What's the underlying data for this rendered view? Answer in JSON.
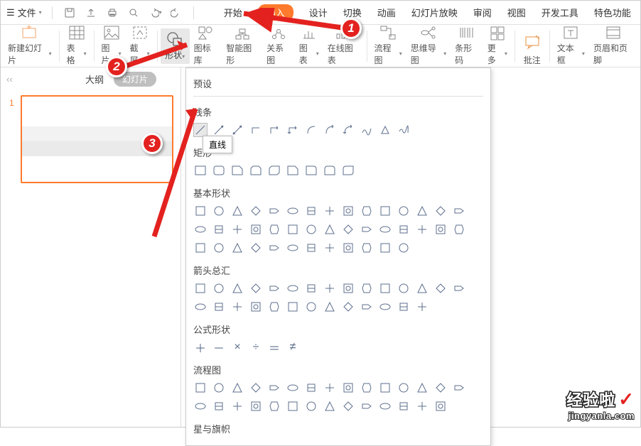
{
  "menubar": {
    "file_label": "文件",
    "tabs": [
      "开始",
      "插入",
      "设计",
      "切换",
      "动画",
      "幻灯片放映",
      "审阅",
      "视图",
      "开发工具",
      "特色功能"
    ],
    "active_tab_index": 1
  },
  "ribbon": {
    "new_slide": "新建幻灯片",
    "table": "表格",
    "image": "图片",
    "screenshot": "截屏",
    "shapes": "形状",
    "icon_lib": "图标库",
    "smart_shape": "智能图形",
    "relation": "关系图",
    "chart": "图表",
    "online_chart": "在线图表",
    "flowchart": "流程图",
    "mindmap": "思维导图",
    "barcode": "条形码",
    "more": "更多",
    "annotate": "批注",
    "textbox": "文本框",
    "header_footer": "页眉和页脚"
  },
  "left_pane": {
    "outline": "大纲",
    "slides": "幻灯片",
    "slide_index": "1"
  },
  "shapes_panel": {
    "presets": "预设",
    "lines": "线条",
    "rectangles": "矩形",
    "basic_shapes": "基本形状",
    "arrows": "箭头总汇",
    "formula": "公式形状",
    "flowchart": "流程图",
    "stars": "星与旗帜"
  },
  "tooltip": {
    "text": "直线"
  },
  "markers": {
    "one": "1",
    "two": "2",
    "three": "3"
  },
  "watermark": {
    "brand": "经验啦",
    "url": "jingyanla.com"
  }
}
